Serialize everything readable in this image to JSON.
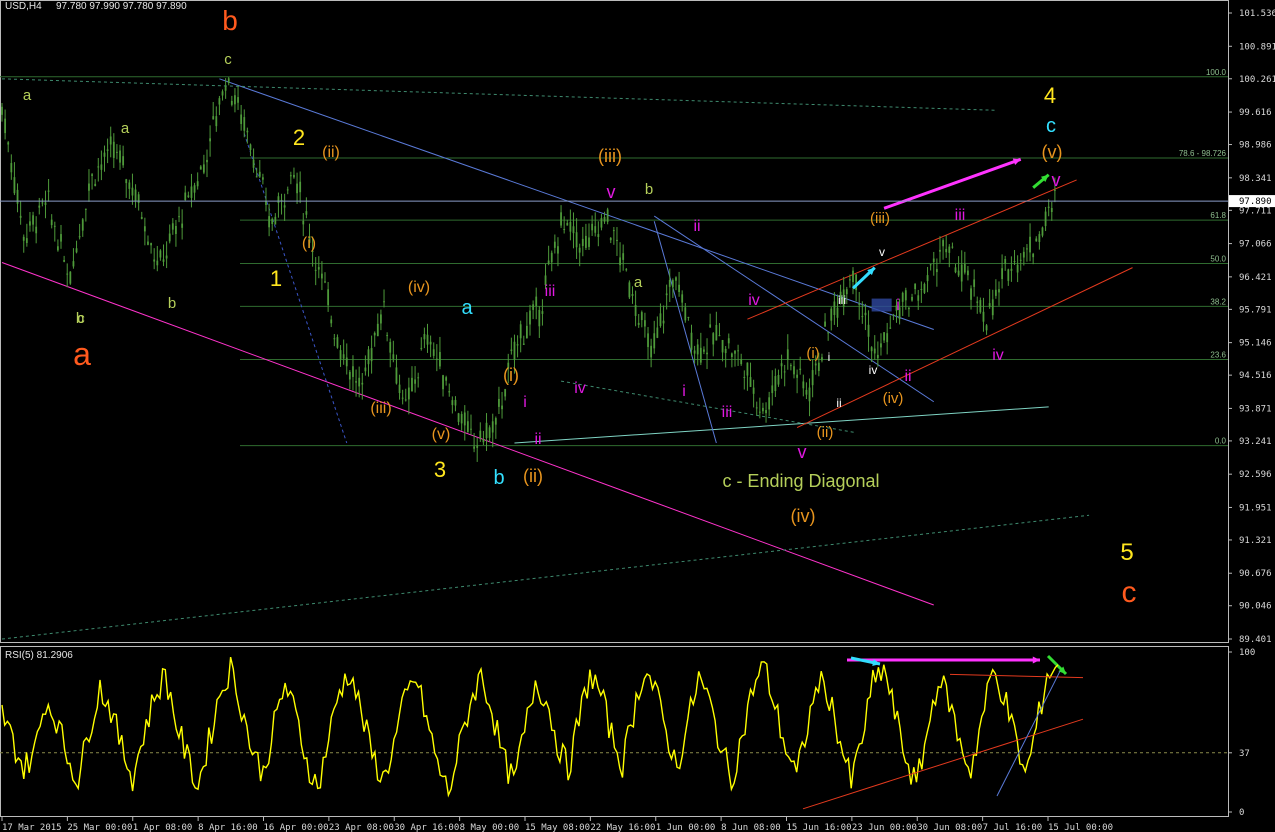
{
  "header": {
    "symbol_tf": "USD,H4",
    "ohlc": "97.780 97.990 97.780 97.890"
  },
  "rsi_header": "RSI(5) 81.2906",
  "colors": {
    "background": "#000000",
    "candles": "#4e9a3a",
    "rsi": "#ffff00",
    "grid": "#2f6b2f",
    "price_line": "#8a9cc8"
  },
  "chart_data": {
    "type": "candlestick",
    "title": "",
    "price_axis": {
      "ticks": [
        "101.536",
        "100.891",
        "100.261",
        "99.616",
        "98.986",
        "98.341",
        "97.711",
        "97.066",
        "96.421",
        "95.791",
        "95.146",
        "94.516",
        "93.871",
        "93.241",
        "92.596",
        "91.951",
        "91.321",
        "90.676",
        "90.046",
        "89.401"
      ],
      "ylim": [
        89.401,
        101.536
      ]
    },
    "current_price": "97.890",
    "time_axis": [
      "17 Mar 2015",
      "25 Mar 00:00",
      "1 Apr 08:00",
      "8 Apr 16:00",
      "16 Apr 00:00",
      "23 Apr 08:00",
      "30 Apr 16:00",
      "8 May 00:00",
      "15 May 08:00",
      "22 May 16:00",
      "1 Jun 00:00",
      "8 Jun 08:00",
      "15 Jun 16:00",
      "23 Jun 00:00",
      "30 Jun 08:00",
      "7 Jul 16:00",
      "15 Jul 00:00"
    ],
    "fib_levels": [
      {
        "label": "100.0",
        "price": 100.3
      },
      {
        "label": "78.6 - 98.726",
        "price": 98.726
      },
      {
        "label": "61.8",
        "price": 97.52
      },
      {
        "label": "50.0",
        "price": 96.68
      },
      {
        "label": "38.2",
        "price": 95.85
      },
      {
        "label": "23.6",
        "price": 94.82
      },
      {
        "label": "0.0",
        "price": 93.15
      }
    ],
    "price_path": [
      {
        "t": "17 Mar 2015",
        "p": 99.7
      },
      {
        "t": "19 Mar",
        "p": 97.2
      },
      {
        "t": "21 Mar",
        "p": 97.9
      },
      {
        "t": "23 Mar",
        "p": 96.4
      },
      {
        "t": "24 Mar",
        "p": 98.4
      },
      {
        "t": "27 Mar",
        "p": 98.9
      },
      {
        "t": "30 Mar",
        "p": 98.0
      },
      {
        "t": "1 Apr",
        "p": 96.6
      },
      {
        "t": "3 Apr",
        "p": 97.6
      },
      {
        "t": "6 Apr",
        "p": 98.6
      },
      {
        "t": "8 Apr",
        "p": 100.3
      },
      {
        "t": "10 Apr",
        "p": 99.2
      },
      {
        "t": "14 Apr",
        "p": 97.4
      },
      {
        "t": "17 Apr",
        "p": 98.5
      },
      {
        "t": "20 Apr",
        "p": 96.8
      },
      {
        "t": "23 Apr",
        "p": 95.2
      },
      {
        "t": "27 Apr",
        "p": 94.2
      },
      {
        "t": "29 Apr",
        "p": 95.9
      },
      {
        "t": "4 May",
        "p": 93.8
      },
      {
        "t": "6 May",
        "p": 95.3
      },
      {
        "t": "8 May",
        "p": 94.2
      },
      {
        "t": "13 May",
        "p": 93.2
      },
      {
        "t": "15 May",
        "p": 93.5
      },
      {
        "t": "18 May",
        "p": 95.2
      },
      {
        "t": "20 May",
        "p": 95.8
      },
      {
        "t": "22 May",
        "p": 97.5
      },
      {
        "t": "26 May",
        "p": 97.0
      },
      {
        "t": "28 May",
        "p": 97.6
      },
      {
        "t": "1 Jun",
        "p": 96.3
      },
      {
        "t": "3 Jun",
        "p": 94.9
      },
      {
        "t": "5 Jun",
        "p": 96.5
      },
      {
        "t": "8 Jun",
        "p": 95.0
      },
      {
        "t": "10 Jun",
        "p": 95.3
      },
      {
        "t": "12 Jun",
        "p": 94.8
      },
      {
        "t": "15 Jun",
        "p": 93.8
      },
      {
        "t": "17 Jun",
        "p": 94.9
      },
      {
        "t": "19 Jun",
        "p": 94.2
      },
      {
        "t": "22 Jun",
        "p": 95.6
      },
      {
        "t": "24 Jun",
        "p": 96.6
      },
      {
        "t": "26 Jun",
        "p": 94.8
      },
      {
        "t": "29 Jun",
        "p": 95.8
      },
      {
        "t": "1 Jul",
        "p": 96.1
      },
      {
        "t": "3 Jul",
        "p": 97.0
      },
      {
        "t": "6 Jul",
        "p": 96.4
      },
      {
        "t": "8 Jul",
        "p": 95.6
      },
      {
        "t": "9 Jul",
        "p": 96.7
      },
      {
        "t": "13 Jul",
        "p": 97.0
      },
      {
        "t": "16 Jul",
        "p": 97.9
      }
    ],
    "rsi_axis": {
      "ticks": [
        "100",
        "37",
        "0"
      ],
      "ylim": [
        0,
        100
      ],
      "mid_level": 37
    },
    "rsi_values": [
      62,
      44,
      27,
      38,
      70,
      58,
      35,
      20,
      52,
      78,
      64,
      40,
      22,
      48,
      72,
      86,
      56,
      34,
      16,
      44,
      74,
      90,
      66,
      38,
      24,
      54,
      80,
      60,
      32,
      14,
      46,
      76,
      88,
      62,
      36,
      20,
      42,
      70,
      84,
      58,
      30,
      12,
      40,
      68,
      86,
      64,
      34,
      18,
      50,
      82,
      70,
      44,
      26,
      58,
      86,
      74,
      48,
      30,
      62,
      90,
      76,
      50,
      28,
      56,
      84,
      68,
      42,
      20,
      48,
      78,
      92,
      66,
      40,
      22,
      54,
      82,
      72,
      44,
      18,
      46,
      80,
      90,
      62,
      34,
      16,
      50,
      84,
      70,
      42,
      26,
      58,
      88,
      74,
      48,
      22,
      52,
      86,
      92
    ],
    "wave_labels": [
      "b",
      "c",
      "a",
      "c",
      "a",
      "b",
      "a",
      "b",
      "2",
      "(ii)",
      "(i)",
      "1",
      "(iii)",
      "(iv)",
      "(v)",
      "3",
      "a",
      "(i)",
      "i",
      "ii",
      "(ii)",
      "b",
      "(iii)",
      "v",
      "b",
      "iii",
      "iv",
      "a",
      "ii",
      "iv",
      "i",
      "iii",
      "c - Ending Diagonal",
      "(iv)",
      "v",
      "(i)",
      "i",
      "ii",
      "(ii)",
      "(iii)",
      "v",
      "iii",
      "i",
      "iv",
      "ii",
      "(iv)",
      "iii",
      "iv",
      "4",
      "c",
      "(v)",
      "v",
      "5",
      "c"
    ]
  }
}
